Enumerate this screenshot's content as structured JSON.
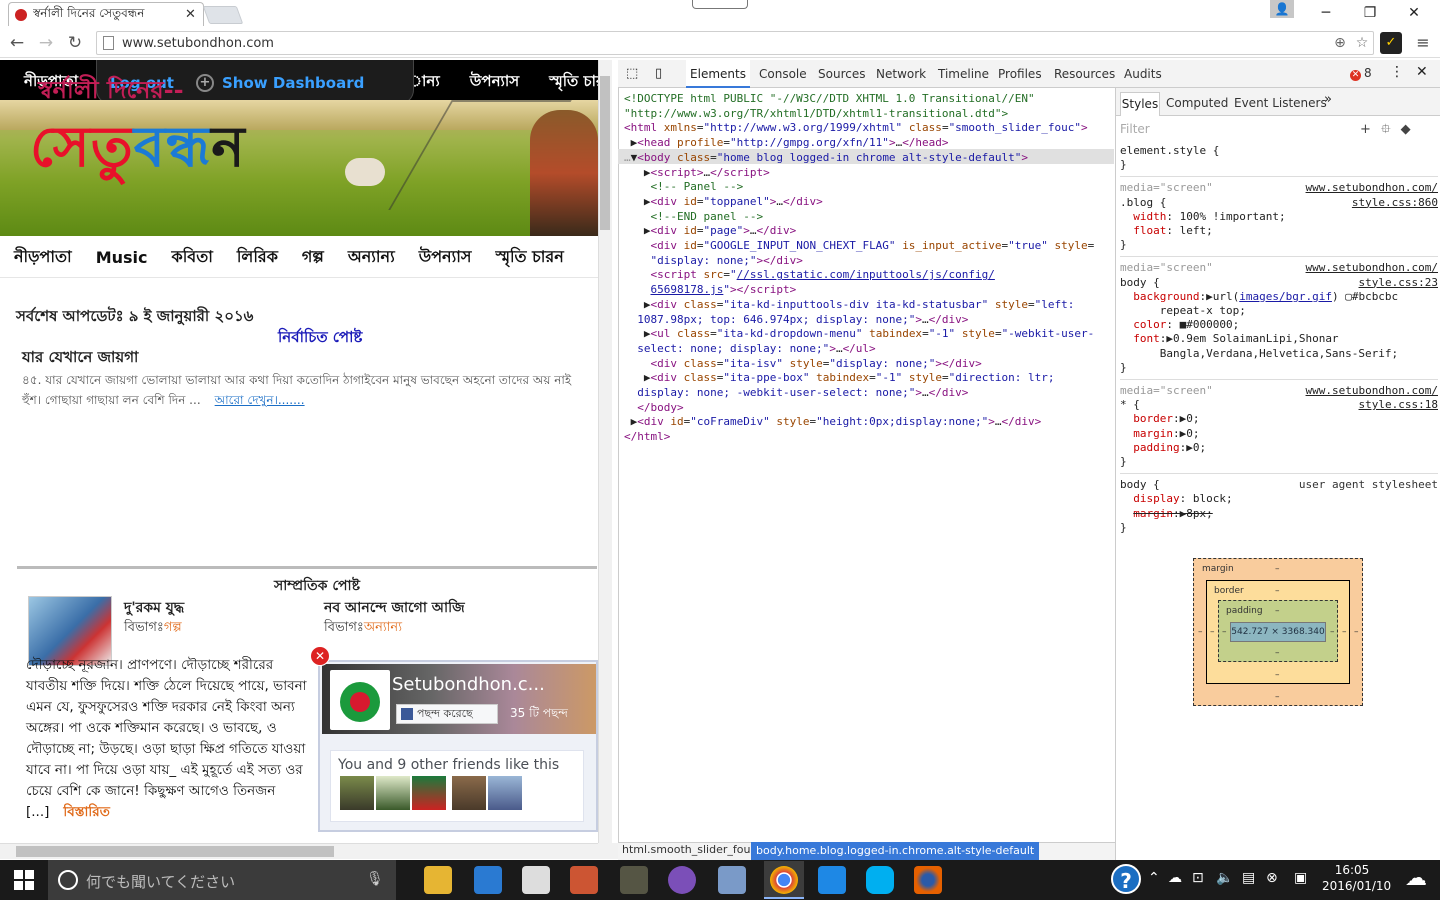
{
  "browser": {
    "tab_title": "স্বর্নালী দিনের সেতুবন্ধন",
    "url": "www.setubondhon.com"
  },
  "page": {
    "topbar": {
      "left_label": "নীড়পাতা",
      "right_labels": [
        "ান্য",
        "উপন্যাস",
        "স্মৃতি চার"
      ],
      "logout": "Log out",
      "dashboard": "Show Dashboard"
    },
    "banner": {
      "line1": "স্বর্নালী দিনের--",
      "line2_parts": [
        "সেতু",
        "বন্",
        "ধন"
      ]
    },
    "nav": [
      "নীড়পাতা",
      "Music",
      "কবিতা",
      "লিরিক",
      "গল্প",
      "অন্যান্য",
      "উপন্যাস",
      "স্মৃতি চারন"
    ],
    "update_line": "সর্বশেষ আপডেটঃ ৯ ই জানুয়ারী ২০১৬",
    "featured": {
      "heading": "নির্বাচিত পোষ্ট",
      "title": "যার যেখানে জায়গা",
      "excerpt": "৪৫. যার যেখানে জায়গা ভোলায়া ভালায়া আর কথা দিয়া কতোদিন ঠাগাইবেন মানুষ ভাবছেন অহনো তাদের অয় নাই হুঁশ। গোছায়া গাছায়া লন বেশি দিন ...",
      "more": "আরো দেখুন।......."
    },
    "recent": {
      "heading": "সাম্প্রতিক পোষ্ট",
      "post1": {
        "title": "দু'রকম যুদ্ধ",
        "cat_label": "বিভাগঃ",
        "cat": "গল্প",
        "body": "দৌড়াচ্ছে নূরজান। প্রাণপণে। দৌড়াচ্ছে শরীরের যাবতীয় শক্তি দিয়ে। শক্তি ঠেলে দিয়েছে পায়ে, ভাবনা এমন যে, ফুসফুসেরও শক্তি দরকার নেই কিংবা অন্য অঙ্গের। পা ওকে শক্তিমান করেছে। ও ভাবছে, ও দৌড়াচ্ছে না; উড়ছে। ওড়া ছাড়া ক্ষিপ্র গতিতে যাওয়া যাবে না। পা দিয়ে ওড়া যায়_ এই মুহূর্তে এই সত্য ওর চেয়ে বেশি কে জানে! কিছুক্ষণ আগেও তিনজন [...]",
        "more": "বিস্তারিত"
      },
      "post2": {
        "title": "নব আনন্দে জাগো আজি",
        "cat_label": "বিভাগঃ",
        "cat": "অন্যান্য"
      }
    },
    "facebook": {
      "page_name": "Setubondhon.c...",
      "like_btn": "পছন্দ করেছে",
      "likes": "35 টি পছন্দ",
      "friends_text": "You and 9 other friends like this"
    }
  },
  "devtools": {
    "tabs": [
      "Elements",
      "Console",
      "Sources",
      "Network",
      "Timeline",
      "Profiles",
      "Resources",
      "Audits"
    ],
    "error_count": "8",
    "side_tabs": [
      "Styles",
      "Computed",
      "Event Listeners"
    ],
    "filter_placeholder": "Filter",
    "boxmodel": {
      "margin": "margin",
      "border": "border",
      "padding": "padding",
      "content": "542.727 × 3368.340",
      "dash": "–"
    },
    "breadcrumbs": [
      "html.smooth_slider_fouc",
      "body.home.blog.logged-in.chrome.alt-style-default"
    ]
  },
  "taskbar": {
    "search_placeholder": "何でも聞いてください",
    "time": "16:05",
    "date": "2016/01/10"
  }
}
